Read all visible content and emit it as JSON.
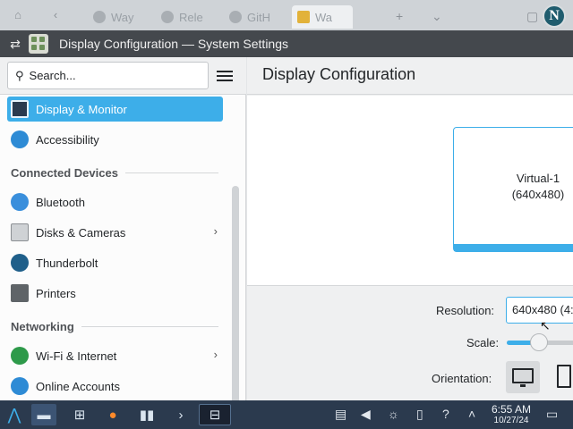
{
  "browser": {
    "tabs": [
      {
        "label": "Way"
      },
      {
        "label": "Rele"
      },
      {
        "label": "GitH"
      },
      {
        "label": "Wa"
      }
    ],
    "profile_letter": "N"
  },
  "window": {
    "title": "Display Configuration — System Settings"
  },
  "sidebar": {
    "search_placeholder": "Search...",
    "items": [
      {
        "label": "Display & Monitor",
        "selected": true,
        "icon": "monitor-icon"
      },
      {
        "label": "Accessibility",
        "icon": "accessibility-icon"
      },
      {
        "section": "Connected Devices"
      },
      {
        "label": "Bluetooth",
        "icon": "bluetooth-icon"
      },
      {
        "label": "Disks & Cameras",
        "icon": "disk-icon",
        "has_children": true
      },
      {
        "label": "Thunderbolt",
        "icon": "thunderbolt-icon"
      },
      {
        "label": "Printers",
        "icon": "printer-icon"
      },
      {
        "section": "Networking"
      },
      {
        "label": "Wi-Fi & Internet",
        "icon": "globe-icon",
        "has_children": true
      },
      {
        "label": "Online Accounts",
        "icon": "online-accounts-icon"
      }
    ]
  },
  "main": {
    "title": "Display Configuration",
    "screen": {
      "name": "Virtual-1",
      "resolution": "(640x480)"
    },
    "resolution_label": "Resolution:",
    "resolution_value": "640x480 (4:",
    "scale_label": "Scale:",
    "scale_level": 0.45,
    "orientation_label": "Orientation:"
  },
  "taskbar": {
    "time": "6:55 AM",
    "date": "10/27/24"
  },
  "colors": {
    "accent": "#3daee9",
    "panel": "#2b3a4e",
    "titlebar": "#44484d"
  }
}
